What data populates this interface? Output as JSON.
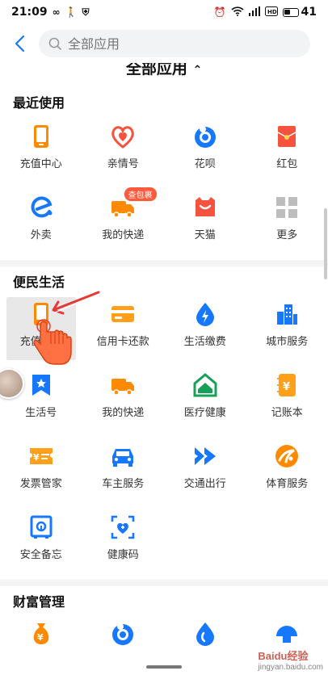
{
  "status_bar": {
    "time": "21:09",
    "battery": "41"
  },
  "search": {
    "placeholder": "全部应用"
  },
  "all_apps_title": "全部应用",
  "sections": {
    "recent": {
      "title": "最近使用",
      "apps": [
        {
          "label": "充值中心",
          "icon": "phone-recharge-icon",
          "badge": ""
        },
        {
          "label": "亲情号",
          "icon": "family-heart-icon",
          "badge": ""
        },
        {
          "label": "花呗",
          "icon": "huabei-icon",
          "badge": ""
        },
        {
          "label": "红包",
          "icon": "red-envelope-icon",
          "badge": ""
        },
        {
          "label": "外卖",
          "icon": "eleme-icon",
          "badge": ""
        },
        {
          "label": "我的快递",
          "icon": "delivery-truck-icon",
          "badge": "查包裹"
        },
        {
          "label": "天猫",
          "icon": "tmall-icon",
          "badge": ""
        },
        {
          "label": "更多",
          "icon": "more-grid-icon",
          "badge": ""
        }
      ]
    },
    "life": {
      "title": "便民生活",
      "apps": [
        {
          "label": "充值中心",
          "icon": "phone-recharge-icon"
        },
        {
          "label": "信用卡还款",
          "icon": "credit-card-icon"
        },
        {
          "label": "生活缴费",
          "icon": "utility-bolt-icon"
        },
        {
          "label": "城市服务",
          "icon": "city-building-icon"
        },
        {
          "label": "生活号",
          "icon": "life-bookmark-icon"
        },
        {
          "label": "我的快递",
          "icon": "delivery-truck-icon"
        },
        {
          "label": "医疗健康",
          "icon": "medical-house-icon"
        },
        {
          "label": "记账本",
          "icon": "account-book-icon"
        },
        {
          "label": "发票管家",
          "icon": "invoice-ticket-icon"
        },
        {
          "label": "车主服务",
          "icon": "car-icon"
        },
        {
          "label": "交通出行",
          "icon": "transport-arrows-icon"
        },
        {
          "label": "体育服务",
          "icon": "sports-runner-icon"
        },
        {
          "label": "安全备忘",
          "icon": "safe-box-icon"
        },
        {
          "label": "健康码",
          "icon": "health-code-icon"
        }
      ]
    },
    "wealth": {
      "title": "财富管理",
      "apps": [
        {
          "label": "",
          "icon": "money-bag-icon"
        },
        {
          "label": "",
          "icon": "huabei-icon"
        },
        {
          "label": "",
          "icon": "water-drop-icon"
        },
        {
          "label": "",
          "icon": "shell-icon"
        }
      ]
    }
  },
  "watermark": {
    "brand": "Baidu经验",
    "site": "jingyan.baidu.com"
  },
  "colors": {
    "orange": "#ff8a00",
    "blue": "#1677ff",
    "red": "#f5533d",
    "green": "#18a058"
  }
}
